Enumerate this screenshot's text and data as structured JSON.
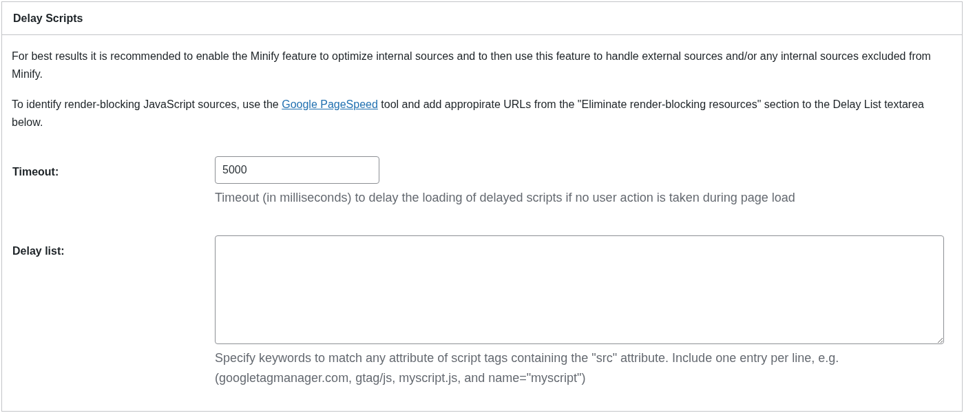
{
  "panel": {
    "title": "Delay Scripts"
  },
  "intro": [
    {
      "before": "For best results it is recommended to enable the Minify feature to optimize internal sources and to then use this feature to handle external sources and/or any internal sources excluded from Minify."
    },
    {
      "before": "To identify render-blocking JavaScript sources, use the ",
      "link": "Google PageSpeed",
      "after": " tool and add appropirate URLs from the \"Eliminate render-blocking resources\" section to the Delay List textarea below."
    }
  ],
  "fields": [
    {
      "kind": "input",
      "label": "Timeout:",
      "value": "5000",
      "description": "Timeout (in milliseconds) to delay the loading of delayed scripts if no user action is taken during page load"
    },
    {
      "kind": "textarea",
      "label": "Delay list:",
      "description": "Specify keywords to match any attribute of script tags containing the \"src\" attribute. Include one entry per line, e.g. (googletagmanager.com, gtag/js, myscript.js, and name=\"myscript\")"
    }
  ]
}
